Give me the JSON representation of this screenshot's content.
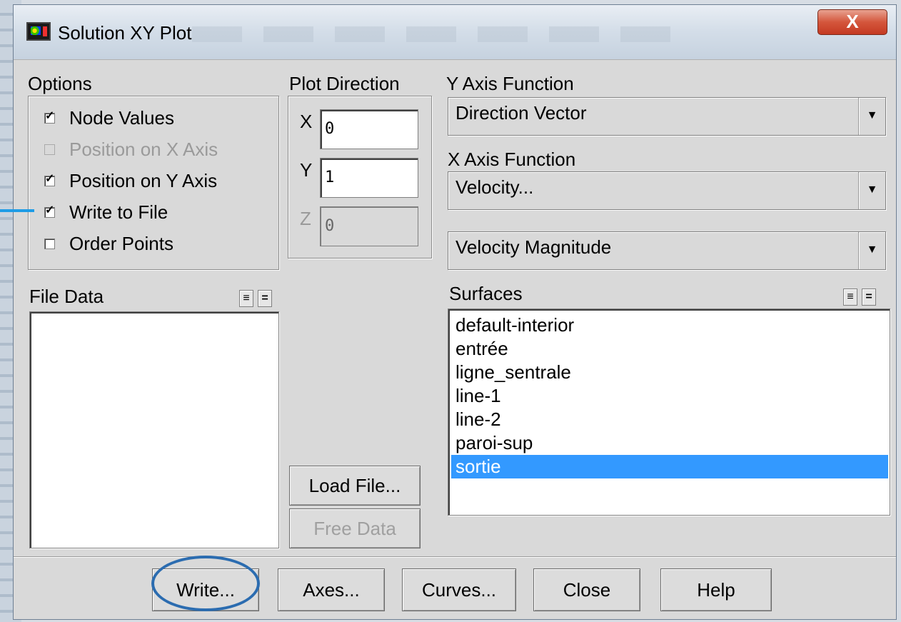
{
  "window": {
    "title": "Solution XY Plot",
    "close_glyph": "X",
    "icon": "fluent-app-icon"
  },
  "options": {
    "heading": "Options",
    "items": [
      {
        "label": "Node Values",
        "checked": true,
        "enabled": true
      },
      {
        "label": "Position on X Axis",
        "checked": false,
        "enabled": false
      },
      {
        "label": "Position on Y Axis",
        "checked": true,
        "enabled": true
      },
      {
        "label": "Write to File",
        "checked": true,
        "enabled": true
      },
      {
        "label": "Order Points",
        "checked": false,
        "enabled": true
      }
    ]
  },
  "plot_direction": {
    "heading": "Plot Direction",
    "x_label": "X",
    "x_value": "0",
    "y_label": "Y",
    "y_value": "1",
    "z_label": "Z",
    "z_value": "0"
  },
  "y_axis_function": {
    "heading": "Y Axis Function",
    "value": "Direction Vector"
  },
  "x_axis_function": {
    "heading": "X Axis Function",
    "category": "Velocity...",
    "value": "Velocity Magnitude"
  },
  "file_data": {
    "heading": "File Data",
    "items": []
  },
  "surfaces": {
    "heading": "Surfaces",
    "items": [
      "default-interior",
      "entrée",
      "ligne_sentrale",
      "line-1",
      "line-2",
      "paroi-sup",
      "sortie"
    ],
    "selected": "sortie"
  },
  "mid_buttons": {
    "load_file": "Load File...",
    "free_data": "Free Data"
  },
  "bottom_buttons": {
    "write": "Write...",
    "axes": "Axes...",
    "curves": "Curves...",
    "close": "Close",
    "help": "Help"
  },
  "colors": {
    "selection": "#3399ff",
    "annotation": "#2b6cb0"
  }
}
